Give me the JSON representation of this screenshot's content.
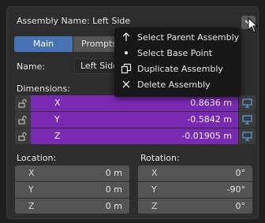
{
  "panel": {
    "title": "Assembly Name: Left Side"
  },
  "tabs": [
    {
      "label": "Main"
    },
    {
      "label": "Prompts"
    }
  ],
  "name_label": "Name:",
  "name_value": "Left Side",
  "dimensions": {
    "label": "Dimensions:",
    "rows": [
      {
        "axis": "X",
        "value": "0.8636 m"
      },
      {
        "axis": "Y",
        "value": "-0.5842 m"
      },
      {
        "axis": "Z",
        "value": "-0.01905 m"
      }
    ]
  },
  "location": {
    "label": "Location:",
    "rows": [
      {
        "axis": "X",
        "value": "0 m"
      },
      {
        "axis": "Y",
        "value": "0 m"
      },
      {
        "axis": "Z",
        "value": "0 m"
      }
    ]
  },
  "rotation": {
    "label": "Rotation:",
    "rows": [
      {
        "axis": "X",
        "value": "0°"
      },
      {
        "axis": "Y",
        "value": "-90°"
      },
      {
        "axis": "Z",
        "value": "0°"
      }
    ]
  },
  "menu": {
    "items": [
      {
        "label": "Select Parent Assembly",
        "icon": "arrow-up-icon"
      },
      {
        "label": "Select Base Point",
        "icon": "dot-icon"
      },
      {
        "label": "Duplicate Assembly",
        "icon": "duplicate-icon"
      },
      {
        "label": "Delete Assembly",
        "icon": "x-icon"
      }
    ]
  },
  "colors": {
    "accent": "#4772b3",
    "dimension_field": "#7a2ab2",
    "monitor_icon": "#5aa0e6"
  }
}
